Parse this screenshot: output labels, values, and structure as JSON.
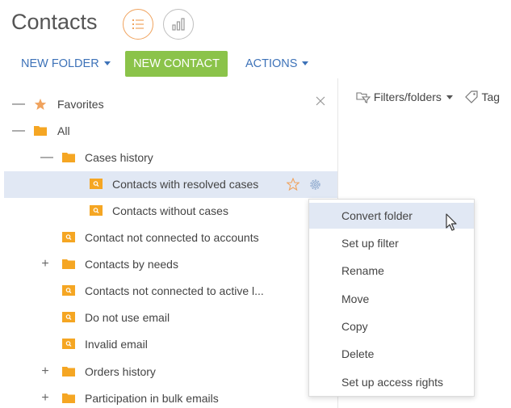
{
  "page": {
    "title": "Contacts"
  },
  "toolbar": {
    "new_folder_label": "NEW FOLDER",
    "new_contact_label": "NEW CONTACT",
    "actions_label": "ACTIONS"
  },
  "view_toggle": {
    "list_icon": "list-icon",
    "chart_icon": "analytics-icon"
  },
  "colors": {
    "accent_green": "#8bc34a",
    "link_blue": "#3d72b8",
    "folder_orange": "#f5a623",
    "star_orange": "#f0a35e",
    "selected_bg": "#e1e8f4"
  },
  "folder_tree": {
    "items": [
      {
        "label": "Favorites",
        "expander": "—",
        "icon": "star-icon"
      },
      {
        "label": "All",
        "expander": "—",
        "icon": "folder-icon"
      },
      {
        "label": "Cases history",
        "expander": "—",
        "icon": "folder-icon"
      },
      {
        "label": "Contacts with resolved cases",
        "expander": "",
        "icon": "search-folder-icon",
        "selected": true
      },
      {
        "label": "Contacts without cases",
        "expander": "",
        "icon": "search-folder-icon"
      },
      {
        "label": "Contact not connected to accounts",
        "expander": "",
        "icon": "search-folder-icon"
      },
      {
        "label": "Contacts by needs",
        "expander": "+",
        "icon": "folder-icon"
      },
      {
        "label": "Contacts not connected to active l...",
        "expander": "",
        "icon": "search-folder-icon"
      },
      {
        "label": "Do not use email",
        "expander": "",
        "icon": "search-folder-icon"
      },
      {
        "label": "Invalid email",
        "expander": "",
        "icon": "search-folder-icon"
      },
      {
        "label": "Orders history",
        "expander": "+",
        "icon": "folder-icon"
      },
      {
        "label": "Participation in bulk emails",
        "expander": "+",
        "icon": "folder-icon"
      }
    ]
  },
  "filter_bar": {
    "filters_label": "Filters/folders",
    "tag_label": "Tag"
  },
  "context_menu": {
    "items": [
      {
        "label": "Convert folder",
        "hover": true
      },
      {
        "label": "Set up filter"
      },
      {
        "label": "Rename"
      },
      {
        "label": "Move"
      },
      {
        "label": "Copy"
      },
      {
        "label": "Delete"
      },
      {
        "label": "Set up access rights"
      }
    ]
  }
}
